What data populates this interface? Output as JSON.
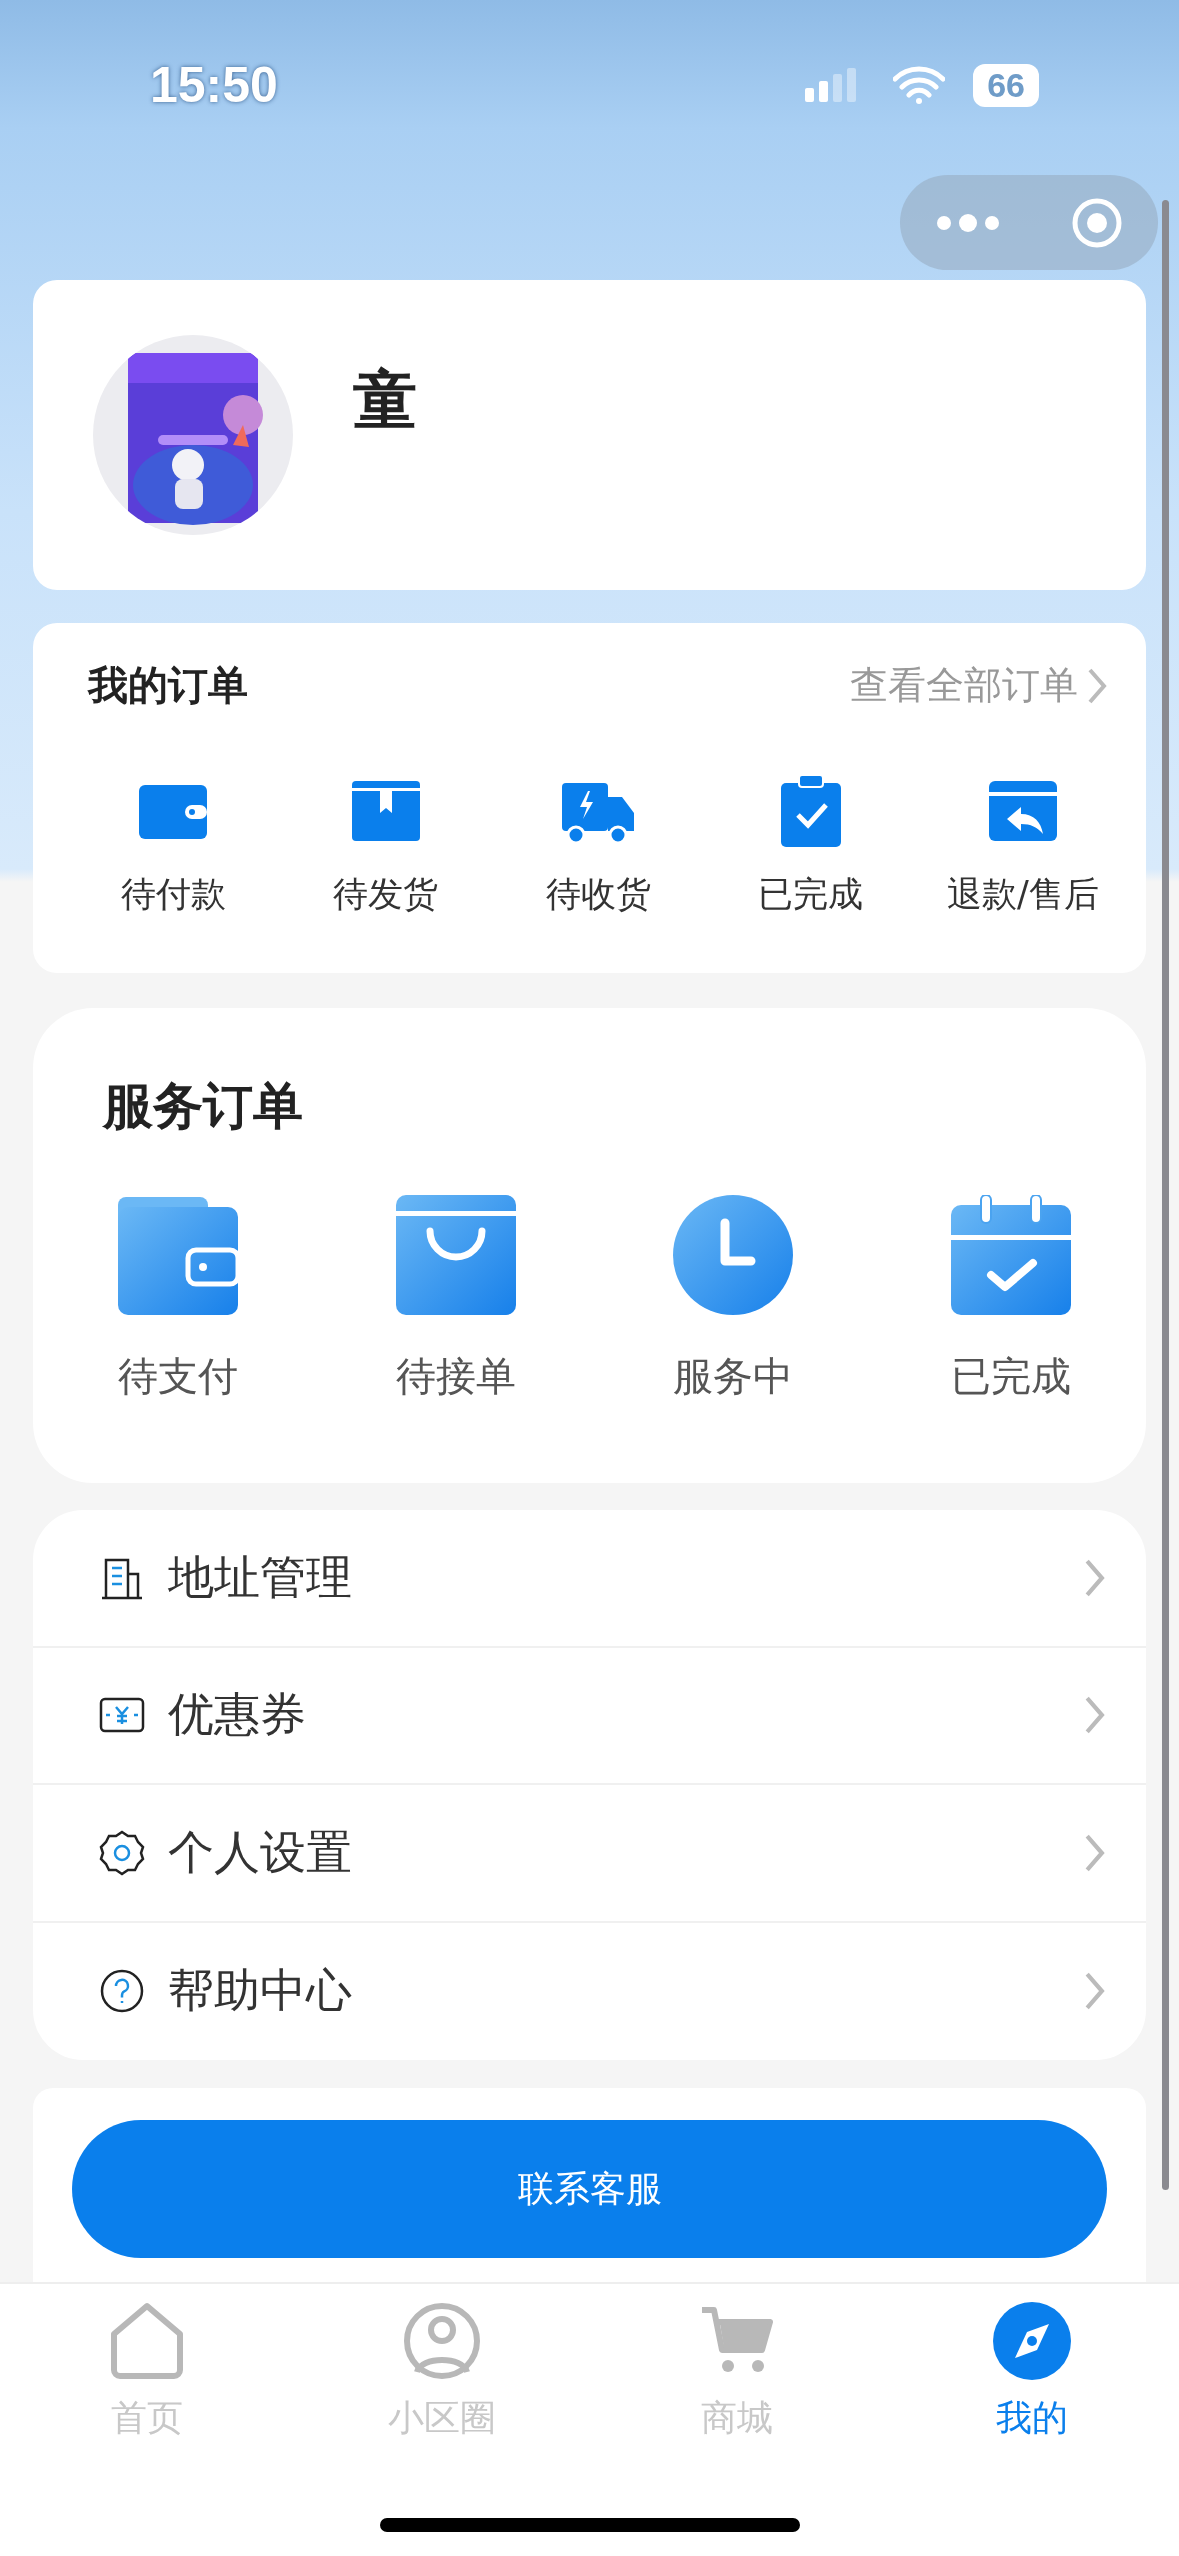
{
  "status_bar": {
    "time": "15:50",
    "battery": "66"
  },
  "profile": {
    "name": "童"
  },
  "my_orders": {
    "title": "我的订单",
    "view_all": "查看全部订单",
    "items": [
      {
        "label": "待付款",
        "kind": "wallet"
      },
      {
        "label": "待发货",
        "kind": "box"
      },
      {
        "label": "待收货",
        "kind": "truck"
      },
      {
        "label": "已完成",
        "kind": "clipboard"
      },
      {
        "label": "退款/售后",
        "kind": "refund"
      }
    ]
  },
  "service_orders": {
    "title": "服务订单",
    "items": [
      {
        "label": "待支付",
        "kind": "wallet"
      },
      {
        "label": "待接单",
        "kind": "bag"
      },
      {
        "label": "服务中",
        "kind": "clock"
      },
      {
        "label": "已完成",
        "kind": "calendar"
      }
    ]
  },
  "menu": [
    {
      "label": "地址管理",
      "kind": "building"
    },
    {
      "label": "优惠券",
      "kind": "coupon"
    },
    {
      "label": "个人设置",
      "kind": "gear"
    },
    {
      "label": "帮助中心",
      "kind": "help"
    }
  ],
  "contact_button": "联系客服",
  "tab_bar": [
    {
      "label": "首页",
      "kind": "home",
      "selected": false
    },
    {
      "label": "小区圈",
      "kind": "person",
      "selected": false
    },
    {
      "label": "商城",
      "kind": "cart",
      "selected": false
    },
    {
      "label": "我的",
      "kind": "compass",
      "selected": true
    }
  ]
}
